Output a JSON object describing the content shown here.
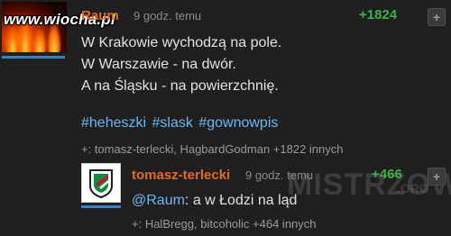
{
  "watermark": {
    "site": "www.wiocha.pl",
    "corner": "MISTRZOWIE",
    "corner_org": ".ORG"
  },
  "entry": {
    "author": "Raum",
    "time": "9 godz. temu",
    "votes": "+1824",
    "lines": [
      "W Krakowie wychodzą na pole.",
      "W Warszawie - na dwór.",
      "A na Śląsku - na powierzchnię."
    ],
    "tags": [
      "#heheszki",
      "#slask",
      "#gownowpis"
    ],
    "voters": "+: tomasz-terlecki, HagbardGodman +1822 innych",
    "plus_label": "+"
  },
  "reply": {
    "author": "tomasz-terlecki",
    "time": "9 godz. temu",
    "votes": "+466",
    "mention": "@Raum",
    "text": ": a w Łodzi na ląd",
    "voters": "+: HalBregg, bitcoholic +464 innych",
    "plus_label": "+"
  },
  "colors": {
    "author": "#e26a22",
    "tag": "#6eb6f0",
    "vote": "#3fae45",
    "background": "#1f1f1f"
  }
}
